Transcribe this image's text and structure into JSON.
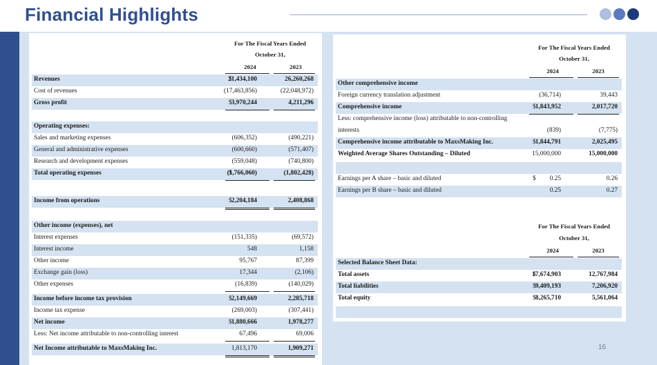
{
  "title": "Financial Highlights",
  "page_number": "16",
  "colors": {
    "title": "#2f4f8f",
    "sidebar": "#2f4f8f",
    "highlight": "#d4e2f1",
    "dot_light": "#aebde0",
    "dot_mid": "#5d79c0",
    "dot_dark": "#1f3a7a"
  },
  "income_statement": {
    "header_line1": "For The Fiscal Years Ended",
    "header_line2": "October 31,",
    "year1": "2024",
    "year2": "2023",
    "rows": [
      {
        "label": "Revenues",
        "cur": "$",
        "v1": "21,434,100",
        "v2": "26,260,268"
      },
      {
        "label": "Cost of revenues",
        "cur": "",
        "v1": "(17,463,856)",
        "v2": "(22,048,972)"
      },
      {
        "label": "Gross profit",
        "cur": "$",
        "v1": "3,970,244",
        "v2": "4,211,296"
      },
      {
        "label": "Operating expenses:",
        "cur": "",
        "v1": "",
        "v2": ""
      },
      {
        "label": "Sales and marketing expenses",
        "cur": "",
        "v1": "(606,352)",
        "v2": "(490,221)"
      },
      {
        "label": "General and administrative expenses",
        "cur": "",
        "v1": "(600,660)",
        "v2": "(571,407)"
      },
      {
        "label": "Research and development expenses",
        "cur": "",
        "v1": "(559,048)",
        "v2": "(740,800)"
      },
      {
        "label": "Total operating expenses",
        "cur": "$",
        "v1": "(1,766,060)",
        "v2": "(1,802,428)"
      },
      {
        "label": "Income from operations",
        "cur": "$",
        "v1": "2,204,184",
        "v2": "2,408,868"
      },
      {
        "label": "Other income (expenses), net",
        "cur": "",
        "v1": "",
        "v2": ""
      },
      {
        "label": "Interest expenses",
        "cur": "",
        "v1": "(151,335)",
        "v2": "(69,572)"
      },
      {
        "label": "Interest income",
        "cur": "",
        "v1": "548",
        "v2": "1,158"
      },
      {
        "label": "Other income",
        "cur": "",
        "v1": "95,767",
        "v2": "87,399"
      },
      {
        "label": "Exchange gain (loss)",
        "cur": "",
        "v1": "17,344",
        "v2": "(2,106)"
      },
      {
        "label": "Other expenses",
        "cur": "",
        "v1": "(16,839)",
        "v2": "(140,029)"
      },
      {
        "label": "Income before income tax provision",
        "cur": "$",
        "v1": "2,149,669",
        "v2": "2,285,718"
      },
      {
        "label": "Income tax expense",
        "cur": "",
        "v1": "(269,003)",
        "v2": "(307,441)"
      },
      {
        "label": "Net income",
        "cur": "$",
        "v1": "1,880,666",
        "v2": "1,978,277"
      },
      {
        "label": "Less: Net income attributable to non-controlling interest",
        "cur": "",
        "v1": "67,496",
        "v2": "69,006"
      },
      {
        "label": "Net Income attributable to MaxsMaking Inc.",
        "cur": "",
        "v1": "1,813,170",
        "v2": "1,909,271"
      }
    ]
  },
  "comprehensive": {
    "header_line1": "For The Fiscal Years Ended",
    "header_line2": "October 31,",
    "year1": "2024",
    "year2": "2023",
    "rows": [
      {
        "label": "Other comprehensive income",
        "cur": "",
        "v1": "",
        "v2": ""
      },
      {
        "label": "Foreign currency translation adjustment",
        "cur": "",
        "v1": "(36,714)",
        "v2": "39,443"
      },
      {
        "label": "Comprehensive income",
        "cur": "$",
        "v1": "1,843,952",
        "v2": "2,017,720"
      },
      {
        "label": "Less: comprehensive income (loss) attributable to non-controlling",
        "cur": "",
        "v1": "",
        "v2": ""
      },
      {
        "label": "interests",
        "cur": "",
        "v1": "(839)",
        "v2": "(7,775)"
      },
      {
        "label": "Comprehensive income attributable to MaxsMaking Inc.",
        "cur": "$",
        "v1": "1,844,791",
        "v2": "2,025,495"
      },
      {
        "label": "Weighted Average Shares Outstanding – Diluted",
        "cur": "",
        "v1": "15,000,000",
        "v2": "15,000,000"
      },
      {
        "label": "",
        "cur": "",
        "v1": "",
        "v2": ""
      },
      {
        "label": "Earnings per A share – basic and diluted",
        "cur": "$",
        "v1": "0.25",
        "v2": "0.26"
      },
      {
        "label": "Earnings per B share – basic and diluted",
        "cur": "",
        "v1": "0.25",
        "v2": "0.27"
      }
    ]
  },
  "balance_sheet": {
    "header_line1": "For The Fiscal Years Ended",
    "header_line2": "October 31,",
    "year1": "2024",
    "year2": "2023",
    "rows": [
      {
        "label": "Selected Balance Sheet Data:",
        "cur": "",
        "v1": "",
        "v2": ""
      },
      {
        "label": "Total assets",
        "cur": "$",
        "v1": "17,674,903",
        "v2": "12,767,984"
      },
      {
        "label": "Total liabilities",
        "cur": "$",
        "v1": "9,409,193",
        "v2": "7,206,920"
      },
      {
        "label": "Total equity",
        "cur": "$",
        "v1": "8,265,710",
        "v2": "5,561,064"
      },
      {
        "label": "",
        "cur": "",
        "v1": "",
        "v2": ""
      }
    ]
  }
}
